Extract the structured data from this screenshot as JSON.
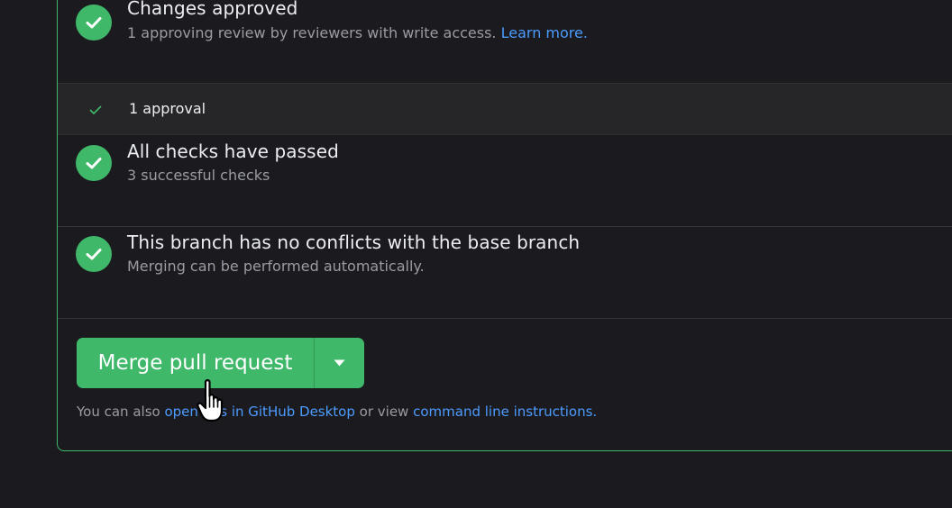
{
  "colors": {
    "accent_green": "#3fb86a",
    "link_blue": "#4c9bff",
    "background": "#1b1b1f",
    "muted_text": "#9a9ba3"
  },
  "approved": {
    "icon": "check-circle-icon",
    "title": "Changes approved",
    "subtitle": "1 approving review by reviewers with write access.",
    "learn_more": "Learn more."
  },
  "approval_row": {
    "icon": "check-icon",
    "label": "1 approval"
  },
  "checks": {
    "icon": "check-circle-icon",
    "title": "All checks have passed",
    "subtitle": "3 successful checks"
  },
  "conflicts": {
    "icon": "check-circle-icon",
    "title": "This branch has no conflicts with the base branch",
    "subtitle": "Merging can be performed automatically."
  },
  "merge": {
    "button_label": "Merge pull request",
    "dropdown_icon": "caret-down-icon"
  },
  "footer": {
    "prefix": "You can also",
    "open_link": "open this in GitHub Desktop",
    "middle": "or view",
    "cli_link": "command line instructions."
  },
  "cursor": {
    "icon": "hand-pointer-cursor-icon"
  }
}
